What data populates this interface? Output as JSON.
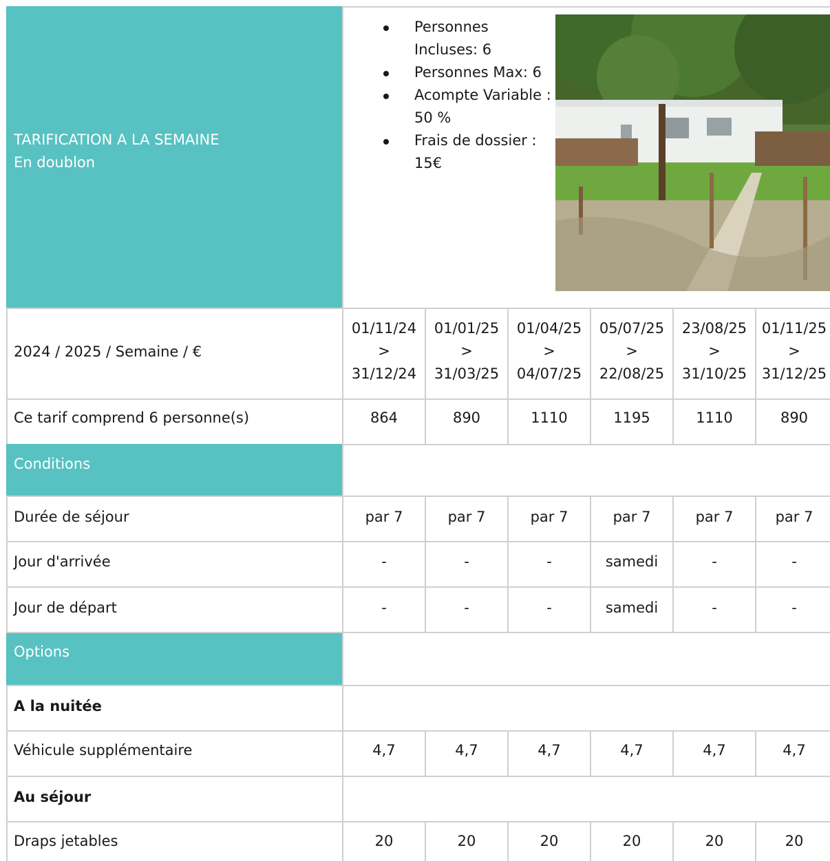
{
  "header": {
    "title": "TARIFICATION A LA SEMAINE",
    "subtitle": "En doublon",
    "specs": [
      "Personnes Incluses: 6",
      "Personnes Max: 6",
      "Acompte Variable : 50 %",
      "Frais de dossier : 15€"
    ]
  },
  "periods": {
    "label": "2024 / 2025 / Semaine / €",
    "items": [
      {
        "start": "01/11/24",
        "sep": ">",
        "end": "31/12/24"
      },
      {
        "start": "01/01/25",
        "sep": ">",
        "end": "31/03/25"
      },
      {
        "start": "01/04/25",
        "sep": ">",
        "end": "04/07/25"
      },
      {
        "start": "05/07/25",
        "sep": ">",
        "end": "22/08/25"
      },
      {
        "start": "23/08/25",
        "sep": ">",
        "end": "31/10/25"
      },
      {
        "start": "01/11/25",
        "sep": ">",
        "end": "31/12/25"
      }
    ]
  },
  "price_row": {
    "label": "Ce tarif comprend 6 personne(s)",
    "values": [
      "864",
      "890",
      "1110",
      "1195",
      "1110",
      "890"
    ]
  },
  "conditions": {
    "title": "Conditions",
    "rows": [
      {
        "label": "Durée de séjour",
        "values": [
          "par 7",
          "par 7",
          "par 7",
          "par 7",
          "par 7",
          "par 7"
        ]
      },
      {
        "label": "Jour d'arrivée",
        "values": [
          "-",
          "-",
          "-",
          "samedi",
          "-",
          "-"
        ]
      },
      {
        "label": "Jour de départ",
        "values": [
          "-",
          "-",
          "-",
          "samedi",
          "-",
          "-"
        ]
      }
    ]
  },
  "options": {
    "title": "Options",
    "night_heading": "A la nuitée",
    "night_rows": [
      {
        "label": "Véhicule supplémentaire",
        "values": [
          "4,7",
          "4,7",
          "4,7",
          "4,7",
          "4,7",
          "4,7"
        ]
      }
    ],
    "stay_heading": "Au séjour",
    "stay_rows": [
      {
        "label": "Draps jetables",
        "values": [
          "20",
          "20",
          "20",
          "20",
          "20",
          "20"
        ]
      }
    ]
  }
}
